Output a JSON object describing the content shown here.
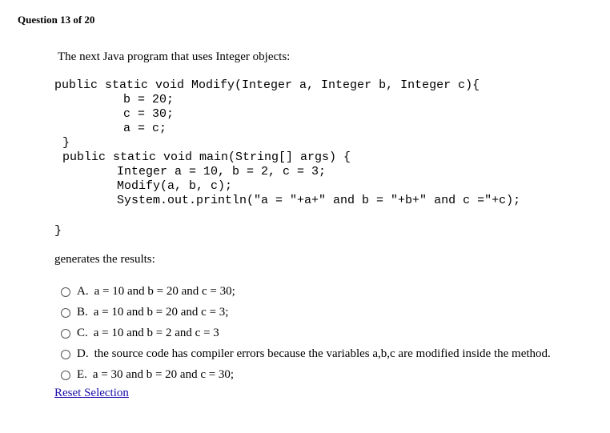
{
  "question_header": "Question 13 of 20",
  "intro_text": "The next Java program that uses Integer objects:",
  "code_lines": [
    "public static void Modify(Integer a, Integer b, Integer c){",
    "b = 20;",
    "c = 30;",
    "a = c;",
    "}",
    "public static void main(String[] args) {",
    "Integer a = 10, b = 2, c = 3;",
    "Modify(a, b, c);",
    "System.out.println(\"a = \"+a+\" and b = \"+b+\" and c =\"+c);",
    "}"
  ],
  "results_label": "generates the results:",
  "options": [
    {
      "letter": "A.",
      "text": "a = 10 and b = 20 and c = 30;"
    },
    {
      "letter": "B.",
      "text": "a = 10 and b = 20 and c = 3;"
    },
    {
      "letter": "C.",
      "text": "a = 10 and b = 2 and c = 3"
    },
    {
      "letter": "D.",
      "text": "the source code has compiler errors because the variables a,b,c are modified inside the method."
    },
    {
      "letter": "E.",
      "text": "a = 30 and b = 20 and c = 30;"
    }
  ],
  "reset_label": "Reset Selection"
}
